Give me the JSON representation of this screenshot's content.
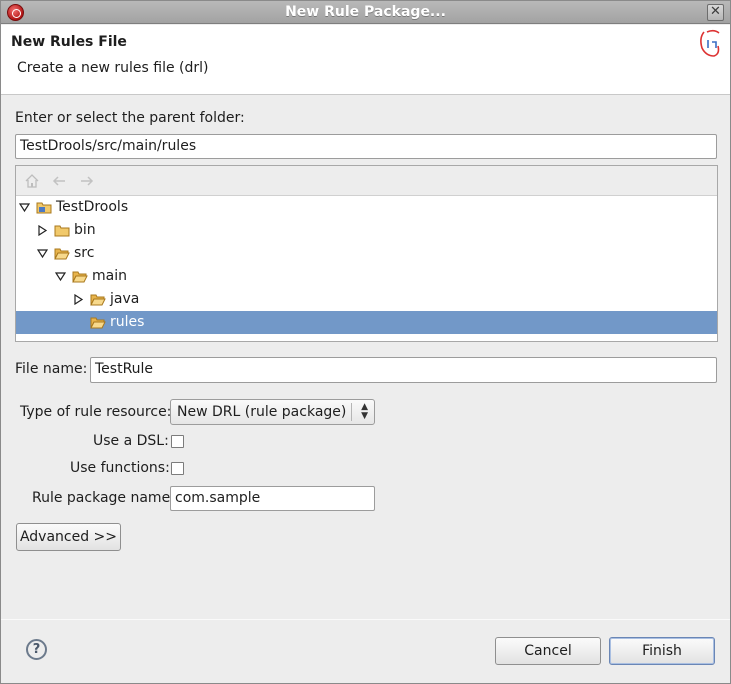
{
  "window": {
    "title": "New Rule Package...",
    "close_glyph": "✕"
  },
  "banner": {
    "title": "New Rules File",
    "description": "Create a new rules file (drl)"
  },
  "folder": {
    "label": "Enter or select the parent folder:",
    "value": "TestDrools/src/main/rules"
  },
  "tree": {
    "toolbar": [
      "home-icon",
      "back-arrow-icon",
      "forward-arrow-icon"
    ],
    "items": [
      {
        "label": "TestDrools",
        "depth": 0,
        "expanded": true,
        "type": "project"
      },
      {
        "label": "bin",
        "depth": 1,
        "expanded": false,
        "type": "folder"
      },
      {
        "label": "src",
        "depth": 1,
        "expanded": true,
        "type": "folder"
      },
      {
        "label": "main",
        "depth": 2,
        "expanded": true,
        "type": "folder"
      },
      {
        "label": "java",
        "depth": 3,
        "expanded": false,
        "type": "folder"
      },
      {
        "label": "rules",
        "depth": 3,
        "expanded": null,
        "type": "folder",
        "selected": true
      }
    ]
  },
  "form": {
    "file_name_label": "File name:",
    "file_name_value": "TestRule",
    "resource_type_label": "Type of rule resource:",
    "resource_type_value": "New DRL (rule package)",
    "use_dsl_label": "Use a DSL:",
    "use_dsl_checked": false,
    "use_functions_label": "Use functions:",
    "use_functions_checked": false,
    "package_name_label": "Rule package name:",
    "package_name_value": "com.sample"
  },
  "buttons": {
    "advanced": "Advanced >>",
    "cancel": "Cancel",
    "finish": "Finish",
    "help_glyph": "?"
  },
  "colors": {
    "selection": "#7298c8",
    "titlebar": "#a2a2a2",
    "folder": "#e8b44c"
  }
}
